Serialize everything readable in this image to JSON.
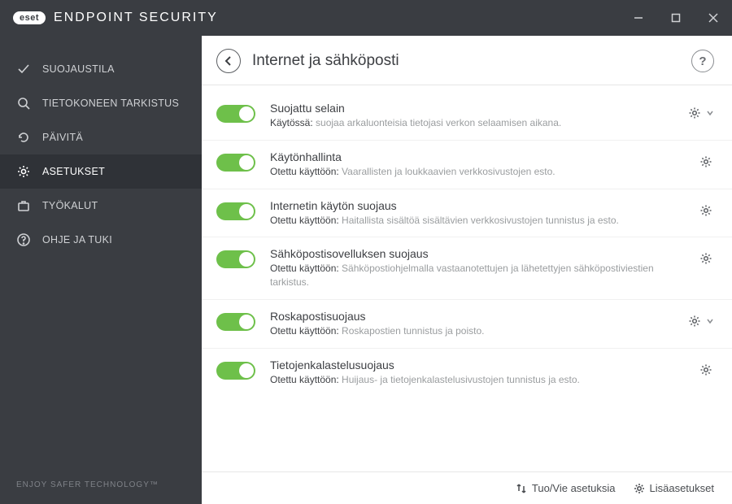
{
  "titlebar": {
    "logo_text": "eset",
    "app_title": "ENDPOINT SECURITY"
  },
  "sidebar": {
    "items": [
      {
        "label": "SUOJAUSTILA",
        "icon": "check"
      },
      {
        "label": "TIETOKONEEN TARKISTUS",
        "icon": "magnifier"
      },
      {
        "label": "PÄIVITÄ",
        "icon": "refresh"
      },
      {
        "label": "ASETUKSET",
        "icon": "gear",
        "active": true
      },
      {
        "label": "TYÖKALUT",
        "icon": "briefcase"
      },
      {
        "label": "OHJE JA TUKI",
        "icon": "help"
      }
    ],
    "tagline": "ENJOY SAFER TECHNOLOGY™"
  },
  "header": {
    "page_title": "Internet ja sähköposti"
  },
  "settings": [
    {
      "title": "Suojattu selain",
      "state": "Käytössä:",
      "desc": "suojaa arkaluonteisia tietojasi verkon selaamisen aikana.",
      "expandable": true
    },
    {
      "title": "Käytönhallinta",
      "state": "Otettu käyttöön:",
      "desc": "Vaarallisten ja loukkaavien verkkosivustojen esto.",
      "expandable": false
    },
    {
      "title": "Internetin käytön suojaus",
      "state": "Otettu käyttöön:",
      "desc": "Haitallista sisältöä sisältävien verkkosivustojen tunnistus ja esto.",
      "expandable": false
    },
    {
      "title": "Sähköpostisovelluksen suojaus",
      "state": "Otettu käyttöön:",
      "desc": "Sähköpostiohjelmalla vastaanotettujen ja lähetettyjen sähköpostiviestien tarkistus.",
      "expandable": false
    },
    {
      "title": "Roskapostisuojaus",
      "state": "Otettu käyttöön:",
      "desc": "Roskapostien tunnistus ja poisto.",
      "expandable": true
    },
    {
      "title": "Tietojenkalastelusuojaus",
      "state": "Otettu käyttöön:",
      "desc": "Huijaus- ja tietojenkalastelusivustojen tunnistus ja esto.",
      "expandable": false
    }
  ],
  "footer": {
    "import_export": "Tuo/Vie asetuksia",
    "advanced": "Lisäasetukset"
  }
}
